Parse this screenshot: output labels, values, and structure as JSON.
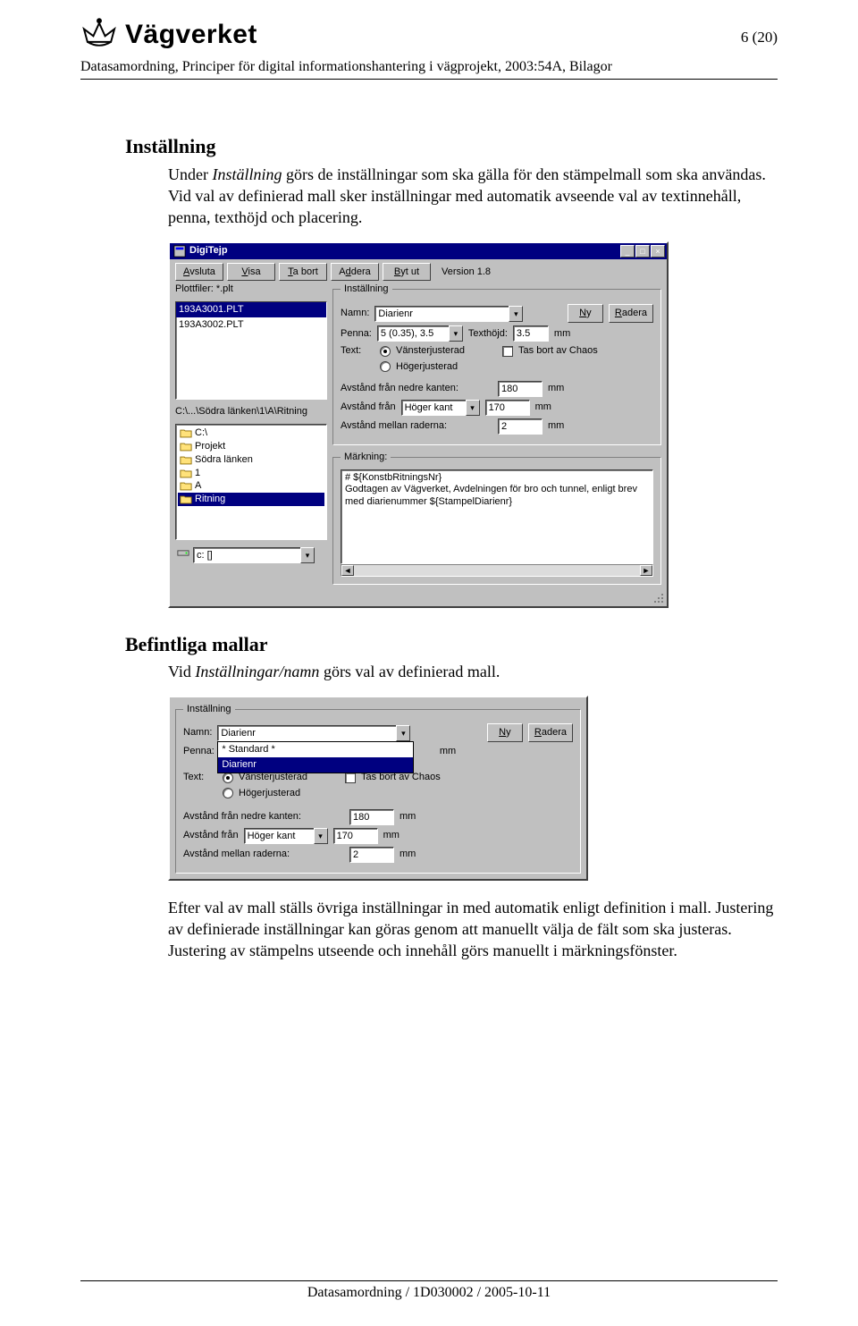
{
  "header": {
    "brand": "Vägverket",
    "page_indicator": "6 (20)",
    "doc_meta": "Datasamordning, Principer för digital informationshantering i vägprojekt, 2003:54A, Bilagor"
  },
  "section1": {
    "title": "Inställning",
    "para_pre": "Under ",
    "para_em": "Inställning",
    "para_post": " görs de inställningar som ska gälla för den stämpelmall som ska användas. Vid val av definierad mall sker inställningar med automatik avseende val av textinnehåll, penna, texthöjd och placering."
  },
  "app": {
    "title": "DigiTejp",
    "toolbar": {
      "avsluta": "Avsluta",
      "visa": "Visa",
      "tabort": "Ta bort",
      "addera": "Addera",
      "bytut": "Byt ut",
      "version": "Version 1.8"
    },
    "plotlabel": "Plottfiler: *.plt",
    "plotfiles": [
      "193A3001.PLT",
      "193A3002.PLT"
    ],
    "pathlabel": "C:\\...\\Södra länken\\1\\A\\Ritning",
    "tree": [
      "C:\\",
      "Projekt",
      "Södra länken",
      "1",
      "A",
      "Ritning"
    ],
    "drive": "c: []",
    "instgroup": {
      "legend": "Inställning",
      "namn_label": "Namn:",
      "namn_value": "Diarienr",
      "ny": "Ny",
      "radera": "Radera",
      "penna_label": "Penna:",
      "penna_value": "5 (0.35), 3.5",
      "texthojd_label": "Texthöjd:",
      "texthojd_value": "3.5",
      "mm": "mm",
      "text_label": "Text:",
      "vanster": "Vänsterjusterad",
      "hoger": "Högerjusterad",
      "tasbort": "Tas bort av Chaos",
      "avst_nedre_label": "Avstånd från nedre kanten:",
      "avst_nedre_value": "180",
      "avst_fran_label": "Avstånd från",
      "avst_fran_combo": "Höger kant",
      "avst_fran_value": "170",
      "avst_rad_label": "Avstånd mellan raderna:",
      "avst_rad_value": "2"
    },
    "markgroup": {
      "legend": "Märkning:",
      "line1": "#       ${KonstbRitningsNr}",
      "line2": "Godtagen av Vägverket, Avdelningen för bro och tunnel, enligt brev med diarienummer ${StampelDiarienr}"
    }
  },
  "section2": {
    "title": "Befintliga mallar",
    "para_pre": "Vid ",
    "para_em": "Inställningar/namn",
    "para_post": " görs val av definierad mall."
  },
  "panel2": {
    "legend": "Inställning",
    "namn_label": "Namn:",
    "namn_value": "Diarienr",
    "opts": [
      "* Standard *",
      "Diarienr"
    ],
    "ny": "Ny",
    "radera": "Radera",
    "penna_label": "Penna:",
    "mm": "mm",
    "text_label": "Text:",
    "vanster": "Vänsterjusterad",
    "hoger": "Högerjusterad",
    "tasbort": "Tas bort av Chaos",
    "avst_nedre_label": "Avstånd från nedre kanten:",
    "avst_nedre_value": "180",
    "avst_fran_label": "Avstånd från",
    "avst_fran_combo": "Höger kant",
    "avst_fran_value": "170",
    "avst_rad_label": "Avstånd mellan raderna:",
    "avst_rad_value": "2"
  },
  "closing": {
    "text": "Efter val av mall ställs övriga inställningar in med automatik enligt definition i mall. Justering av definierade inställningar kan göras genom att manuellt välja de fält som ska justeras. Justering av stämpelns utseende och innehåll görs manuellt i märkningsfönster."
  },
  "footer": "Datasamordning / 1D030002 / 2005-10-11"
}
